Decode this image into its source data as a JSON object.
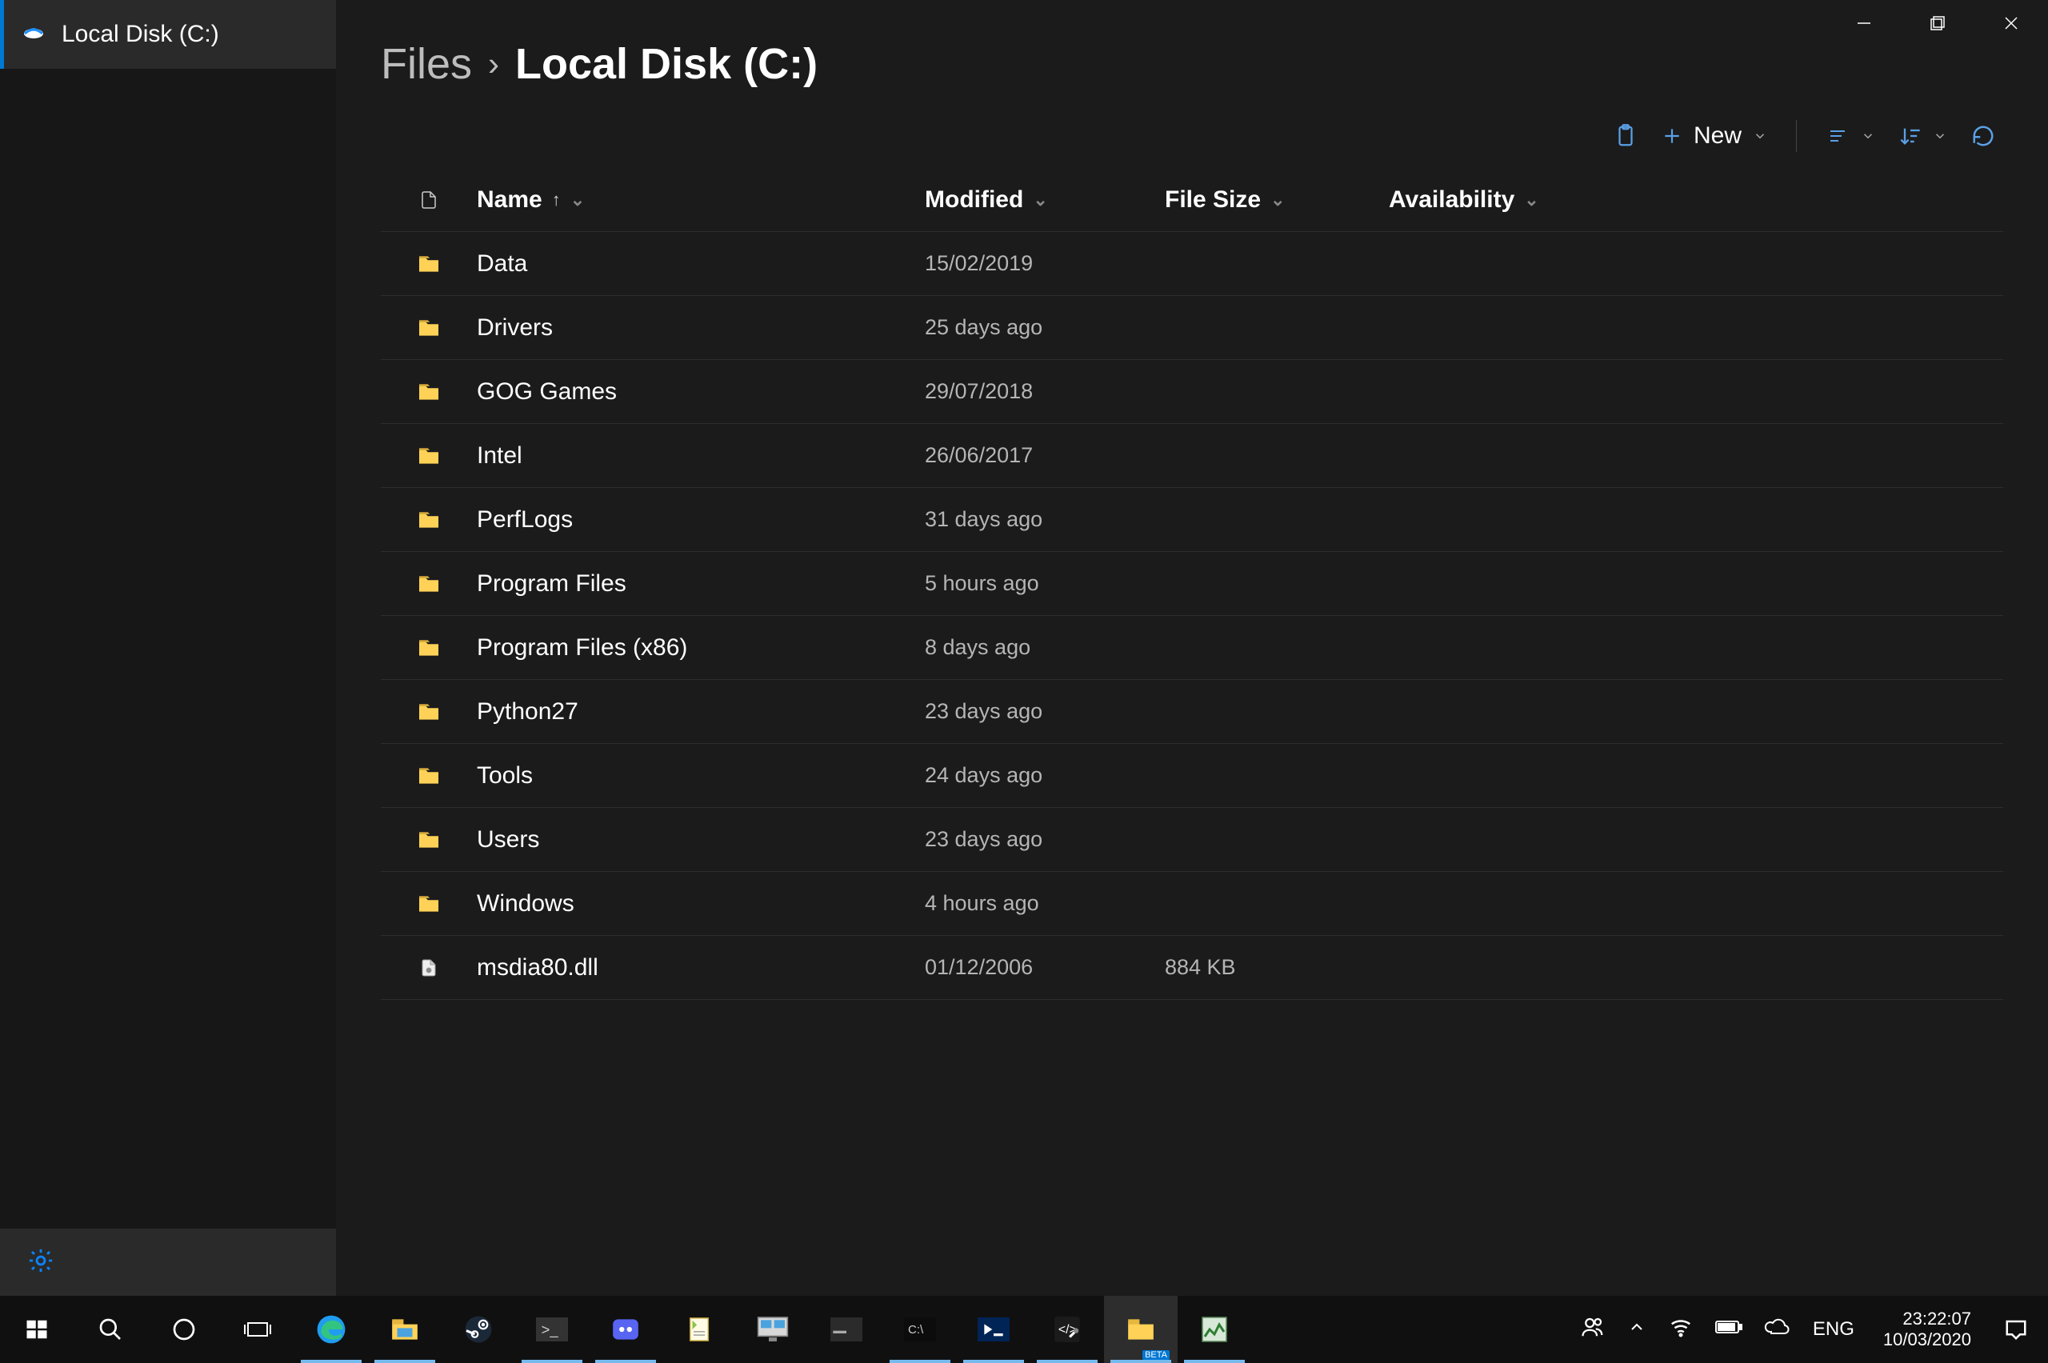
{
  "window": {
    "minimize": "—",
    "maximize": "▢",
    "close": "✕"
  },
  "sidebar": {
    "tab_label": "Local Disk (C:)"
  },
  "breadcrumb": {
    "root": "Files",
    "sep": "›",
    "current": "Local Disk (C:)"
  },
  "toolbar": {
    "new_label": "New"
  },
  "columns": {
    "name": "Name",
    "modified": "Modified",
    "size": "File Size",
    "availability": "Availability"
  },
  "rows": [
    {
      "type": "folder",
      "name": "Data",
      "modified": "15/02/2019",
      "size": "",
      "avail": ""
    },
    {
      "type": "folder",
      "name": "Drivers",
      "modified": "25 days ago",
      "size": "",
      "avail": ""
    },
    {
      "type": "folder",
      "name": "GOG Games",
      "modified": "29/07/2018",
      "size": "",
      "avail": ""
    },
    {
      "type": "folder",
      "name": "Intel",
      "modified": "26/06/2017",
      "size": "",
      "avail": ""
    },
    {
      "type": "folder",
      "name": "PerfLogs",
      "modified": "31 days ago",
      "size": "",
      "avail": ""
    },
    {
      "type": "folder",
      "name": "Program Files",
      "modified": "5 hours ago",
      "size": "",
      "avail": ""
    },
    {
      "type": "folder",
      "name": "Program Files (x86)",
      "modified": "8 days ago",
      "size": "",
      "avail": ""
    },
    {
      "type": "folder",
      "name": "Python27",
      "modified": "23 days ago",
      "size": "",
      "avail": ""
    },
    {
      "type": "folder",
      "name": "Tools",
      "modified": "24 days ago",
      "size": "",
      "avail": ""
    },
    {
      "type": "folder",
      "name": "Users",
      "modified": "23 days ago",
      "size": "",
      "avail": ""
    },
    {
      "type": "folder",
      "name": "Windows",
      "modified": "4 hours ago",
      "size": "",
      "avail": ""
    },
    {
      "type": "file",
      "name": "msdia80.dll",
      "modified": "01/12/2006",
      "size": "884 KB",
      "avail": ""
    }
  ],
  "tray": {
    "lang": "ENG",
    "time": "23:22:07",
    "date": "10/03/2020"
  }
}
